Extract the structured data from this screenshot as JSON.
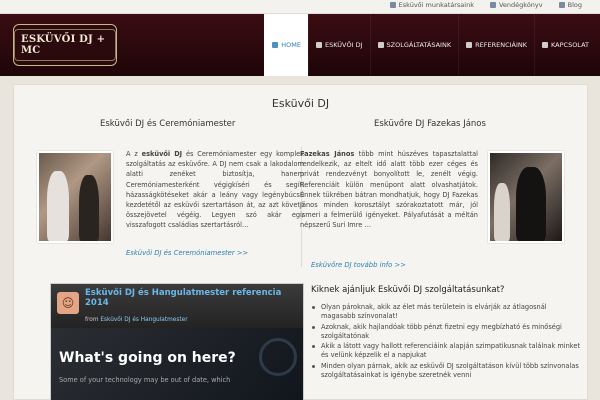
{
  "topbar": {
    "links": [
      {
        "label": "Esküvői munkatársaink",
        "icon": "user-icon"
      },
      {
        "label": "Vendégkönyv",
        "icon": "book-icon"
      },
      {
        "label": "Blog",
        "icon": "rss-icon"
      }
    ]
  },
  "header": {
    "logo_text": "ESKÜVŐI DJ + MC",
    "nav": [
      {
        "label": "HOME",
        "icon": "home-icon",
        "active": true
      },
      {
        "label": "ESKÜVŐI DJ",
        "icon": "music-icon",
        "active": false
      },
      {
        "label": "SZOLGÁLTATÁSAINK",
        "icon": "grid-icon",
        "active": false
      },
      {
        "label": "REFERENCIÁINK",
        "icon": "list-icon",
        "active": false
      },
      {
        "label": "KAPCSOLAT",
        "icon": "mail-icon",
        "active": false
      }
    ],
    "colors": {
      "header_bg": "#2a0a0d",
      "accent": "#2a7fb5"
    }
  },
  "main": {
    "title": "Esküvői DJ",
    "left": {
      "heading": "Esküvői DJ és Ceremóniamester",
      "text_lead": "A z ",
      "text_bold": "esküvői DJ",
      "text": " és Ceremóniamester egy komplex szolgáltatás az esküvőre. A DJ nem csak a lakodalom alatti zenéket biztosítja, hanem Ceremóniamesterként végigkíséri és segíti házasságkötéseket akár a leány vagy legénybúcsú kezdetétől az esküvői szertartáson át, az azt követő összejövetel végéig. Legyen szó akár egy visszafogott családias szertartásról…",
      "more": "Esküvői DJ és Ceremóniamester >>"
    },
    "right": {
      "heading": "Esküvőre DJ Fazekas János",
      "text_bold": "Fazekas János",
      "text": " több mint húszéves tapasztalattal rendelkezik, az eltelt idő alatt több ezer céges és privát rendezvényt bonyolított le, zenélt végig. Referenciáit külön menüpont alatt olvashatjátok. Ennek tükrében bátran mondhatjuk, hogy DJ Fazekas János minden korosztályt szórakoztatott már, jól ismeri a felmerülő igényeket. Pályafutását a méltán népszerű Suri Imre …",
      "more": "Esküvőre DJ tovább info >>"
    }
  },
  "video": {
    "title": "Esküvői DJ és Hangulatmester referencia 2014",
    "from_label": "from",
    "from_name": "Esküvői DJ és Hangulatmester",
    "big_text": "What's going on here?",
    "small_text": "Some of your technology may be out of date, which"
  },
  "recommend": {
    "title": "Kiknek ajánljuk Esküvői DJ szolgáltatásunkat?",
    "items": [
      "Olyan pároknak, akik az élet más területein is elvárják az átlagosnál magasabb színvonalat!",
      "Azoknak, akik hajlandóak több pénzt fizetni egy megbízható és minőségi szolgáltatónak",
      "Akik a látott vagy hallott referenciáink alapján szimpatikusnak találnak minket és velünk képzelik el a napjukat",
      "Minden olyan párnak, akik az esküvői DJ szolgáltatáson kívül több színvonalas szolgáltatásainkat is igénybe szeretnék venni"
    ]
  }
}
